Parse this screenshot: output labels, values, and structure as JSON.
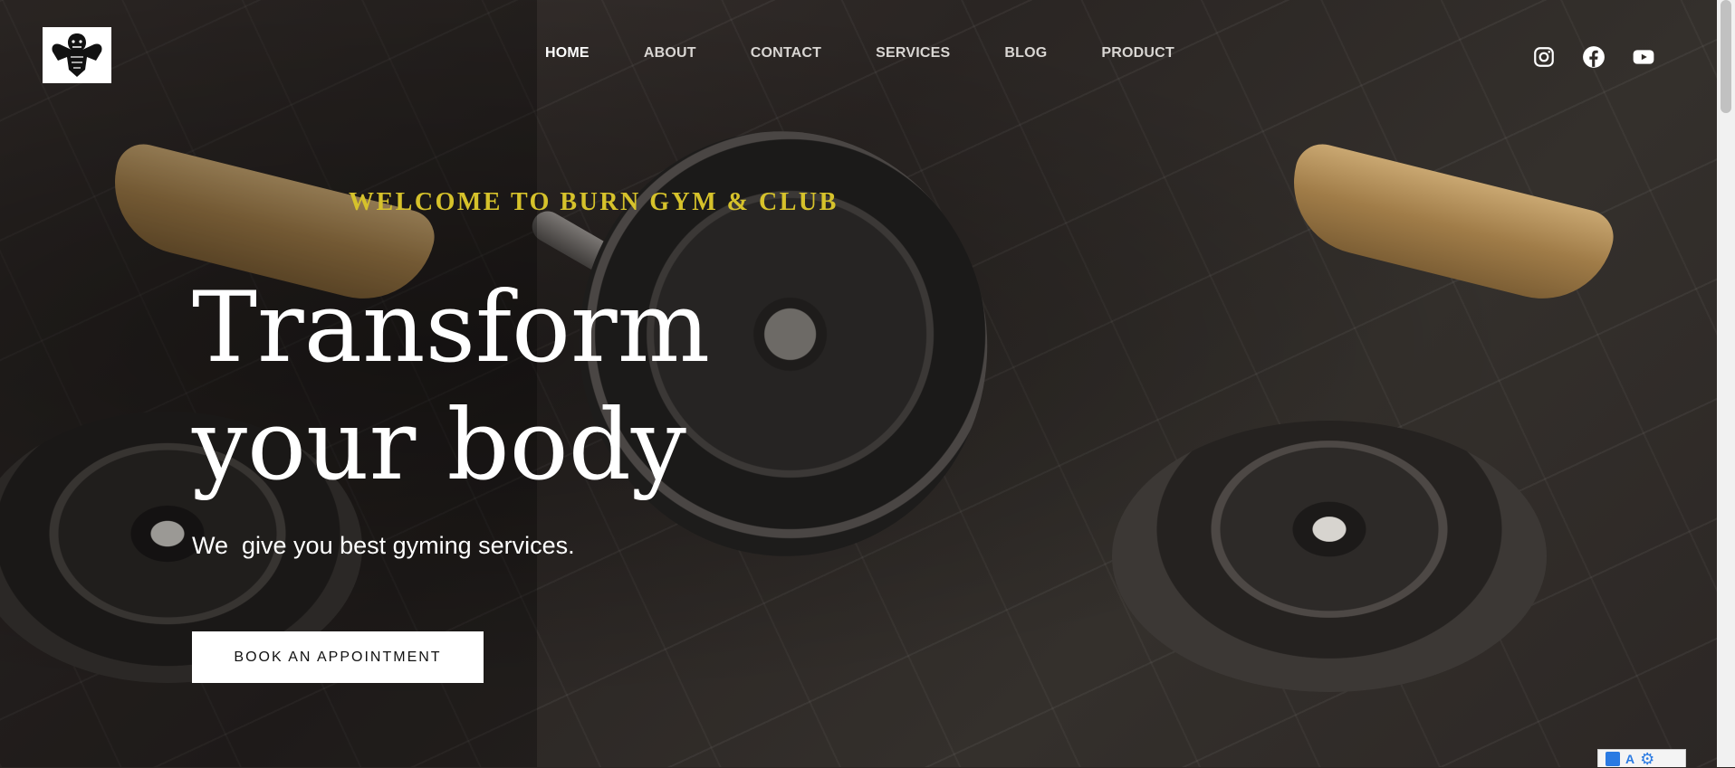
{
  "nav": {
    "items": [
      {
        "label": "HOME",
        "active": true
      },
      {
        "label": "ABOUT",
        "active": false
      },
      {
        "label": "CONTACT",
        "active": false
      },
      {
        "label": "SERVICES",
        "active": false
      },
      {
        "label": "BLOG",
        "active": false
      },
      {
        "label": "PRODUCT",
        "active": false
      }
    ]
  },
  "social": {
    "icons": [
      "instagram-icon",
      "facebook-icon",
      "youtube-icon"
    ]
  },
  "hero": {
    "eyebrow": "WELCOME TO BURN GYM & CLUB",
    "headline_line1": "Transform",
    "headline_line2": "your body",
    "subtext": "We  give you best gyming services.",
    "cta_label": "BOOK AN APPOINTMENT"
  },
  "colors": {
    "accent": "#d6c22b",
    "text": "#ffffff",
    "button_bg": "#ffffff"
  },
  "translate_widget": {
    "label": "A"
  }
}
